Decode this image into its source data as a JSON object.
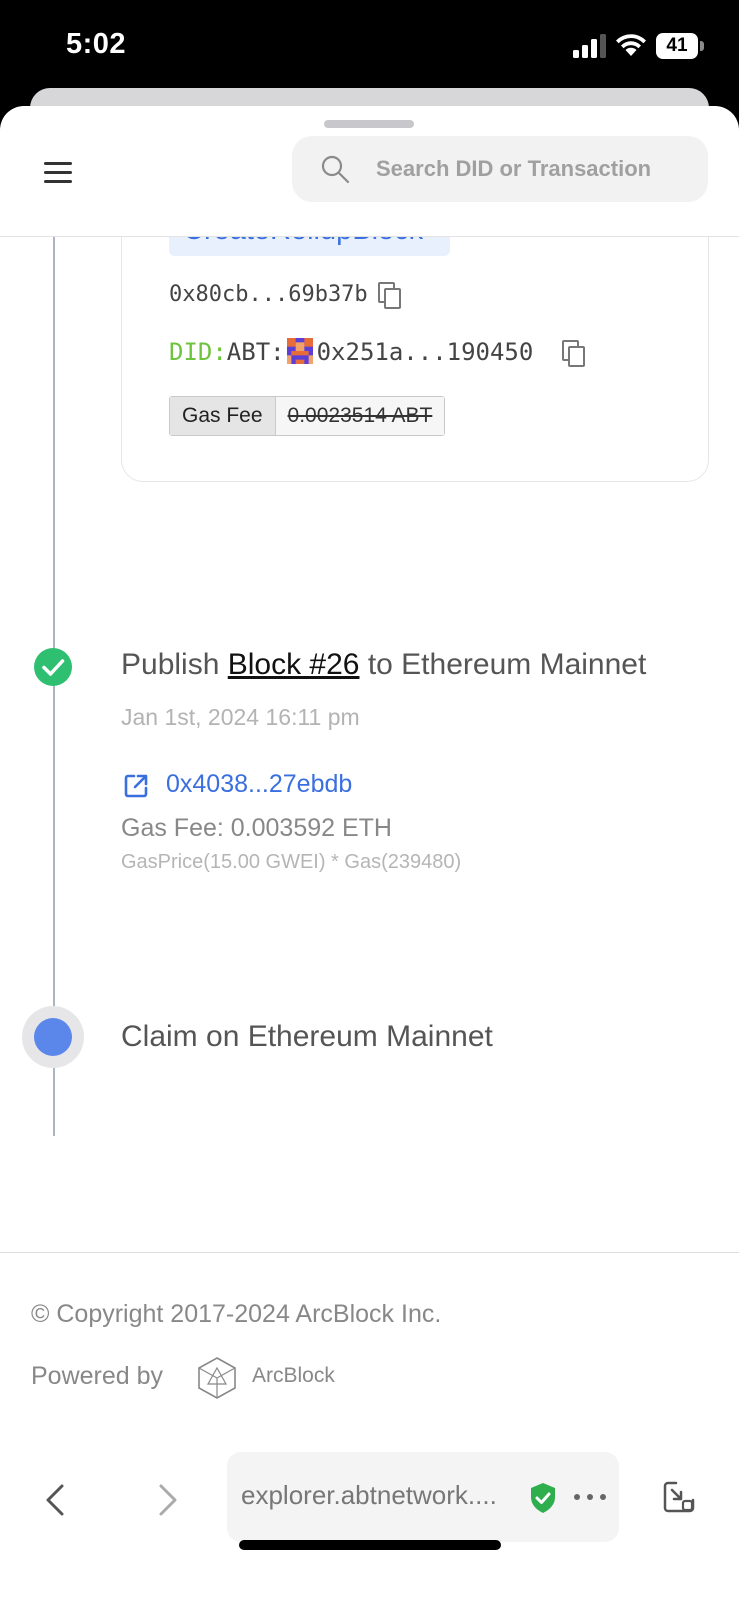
{
  "status_bar": {
    "time": "5:02",
    "battery": "41"
  },
  "header": {
    "search_placeholder": "Search DID or Transaction"
  },
  "transaction_card": {
    "type": "CreateRollupBlock",
    "hash": "0x80cb...69b37b",
    "did_prefix": "DID:",
    "did_type": "ABT:",
    "did_address": "0x251a...190450",
    "gas_fee_label": "Gas Fee",
    "gas_fee_value": "0.0023514 ABT"
  },
  "publish_step": {
    "title_prefix": "Publish ",
    "block_link": "Block #26",
    "title_suffix": " to Ethereum Mainnet",
    "date": "Jan 1st, 2024 16:11 pm",
    "eth_tx_hash": "0x4038...27ebdb",
    "gas_fee": "Gas Fee: 0.003592 ETH",
    "gas_detail": "GasPrice(15.00 GWEI) * Gas(239480)"
  },
  "claim_step": {
    "title": "Claim on Ethereum Mainnet"
  },
  "footer": {
    "copyright": "© Copyright 2017-2024 ArcBlock Inc.",
    "powered_by": "Powered by",
    "brand": "ArcBlock"
  },
  "browser": {
    "url": "explorer.abtnetwork...."
  },
  "colors": {
    "accent": "#3a6fe0",
    "success": "#2fbf71",
    "did_green": "#6ec43e",
    "pending": "#5b87ea"
  },
  "icons": [
    "signal-icon",
    "wifi-icon",
    "menu-icon",
    "search-icon",
    "copy-icon",
    "check-icon",
    "external-link-icon",
    "arcblock-logo",
    "chevron-left-icon",
    "chevron-right-icon",
    "shield-check-icon",
    "more-icon",
    "minimize-icon"
  ]
}
